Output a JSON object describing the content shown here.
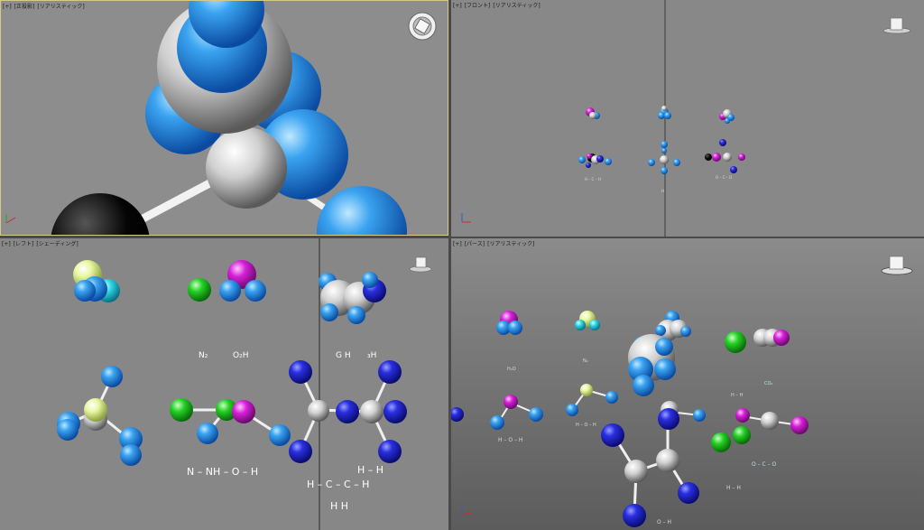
{
  "viewports": {
    "top": {
      "plus": "[+]",
      "view": "[正投影]",
      "shading": "[リアリスティック]"
    },
    "front": {
      "plus": "[+]",
      "view": "[フロント]",
      "shading": "[リアリスティック]"
    },
    "left": {
      "plus": "[+]",
      "view": "[レフト]",
      "shading": "[シェーディング]"
    },
    "persp": {
      "plus": "[+]",
      "view": "[パース]",
      "shading": "[リアリスティック]"
    }
  },
  "left_labels": {
    "n2": "N₂",
    "ohh": "O₂H",
    "gh": "G H",
    "hh": "₃H",
    "formula1": "N – NH – O – H",
    "formula2_top": "H – H",
    "formula2_mid": "H – C – C – H",
    "formula2_bot": "H     H"
  },
  "front_labels": {
    "a": "H – C – H",
    "b": "H",
    "c": "O – C – O"
  },
  "persp_labels": {
    "h2o": "H₂O",
    "nh": "N₂",
    "hoh": "H – O – H",
    "ho": "H – O – H",
    "co2": "CO₂",
    "hh": "H – H",
    "oco": "O – C – O",
    "hah": "H – H",
    "ohh": "O – H"
  },
  "colors": {
    "blue": "#2b8fe6",
    "navy": "#1d22c8",
    "white": "#d8d8d8",
    "green": "#22c922",
    "magenta": "#d41fd8",
    "lime": "#e6f7a0",
    "frame": "#d8c98a"
  }
}
